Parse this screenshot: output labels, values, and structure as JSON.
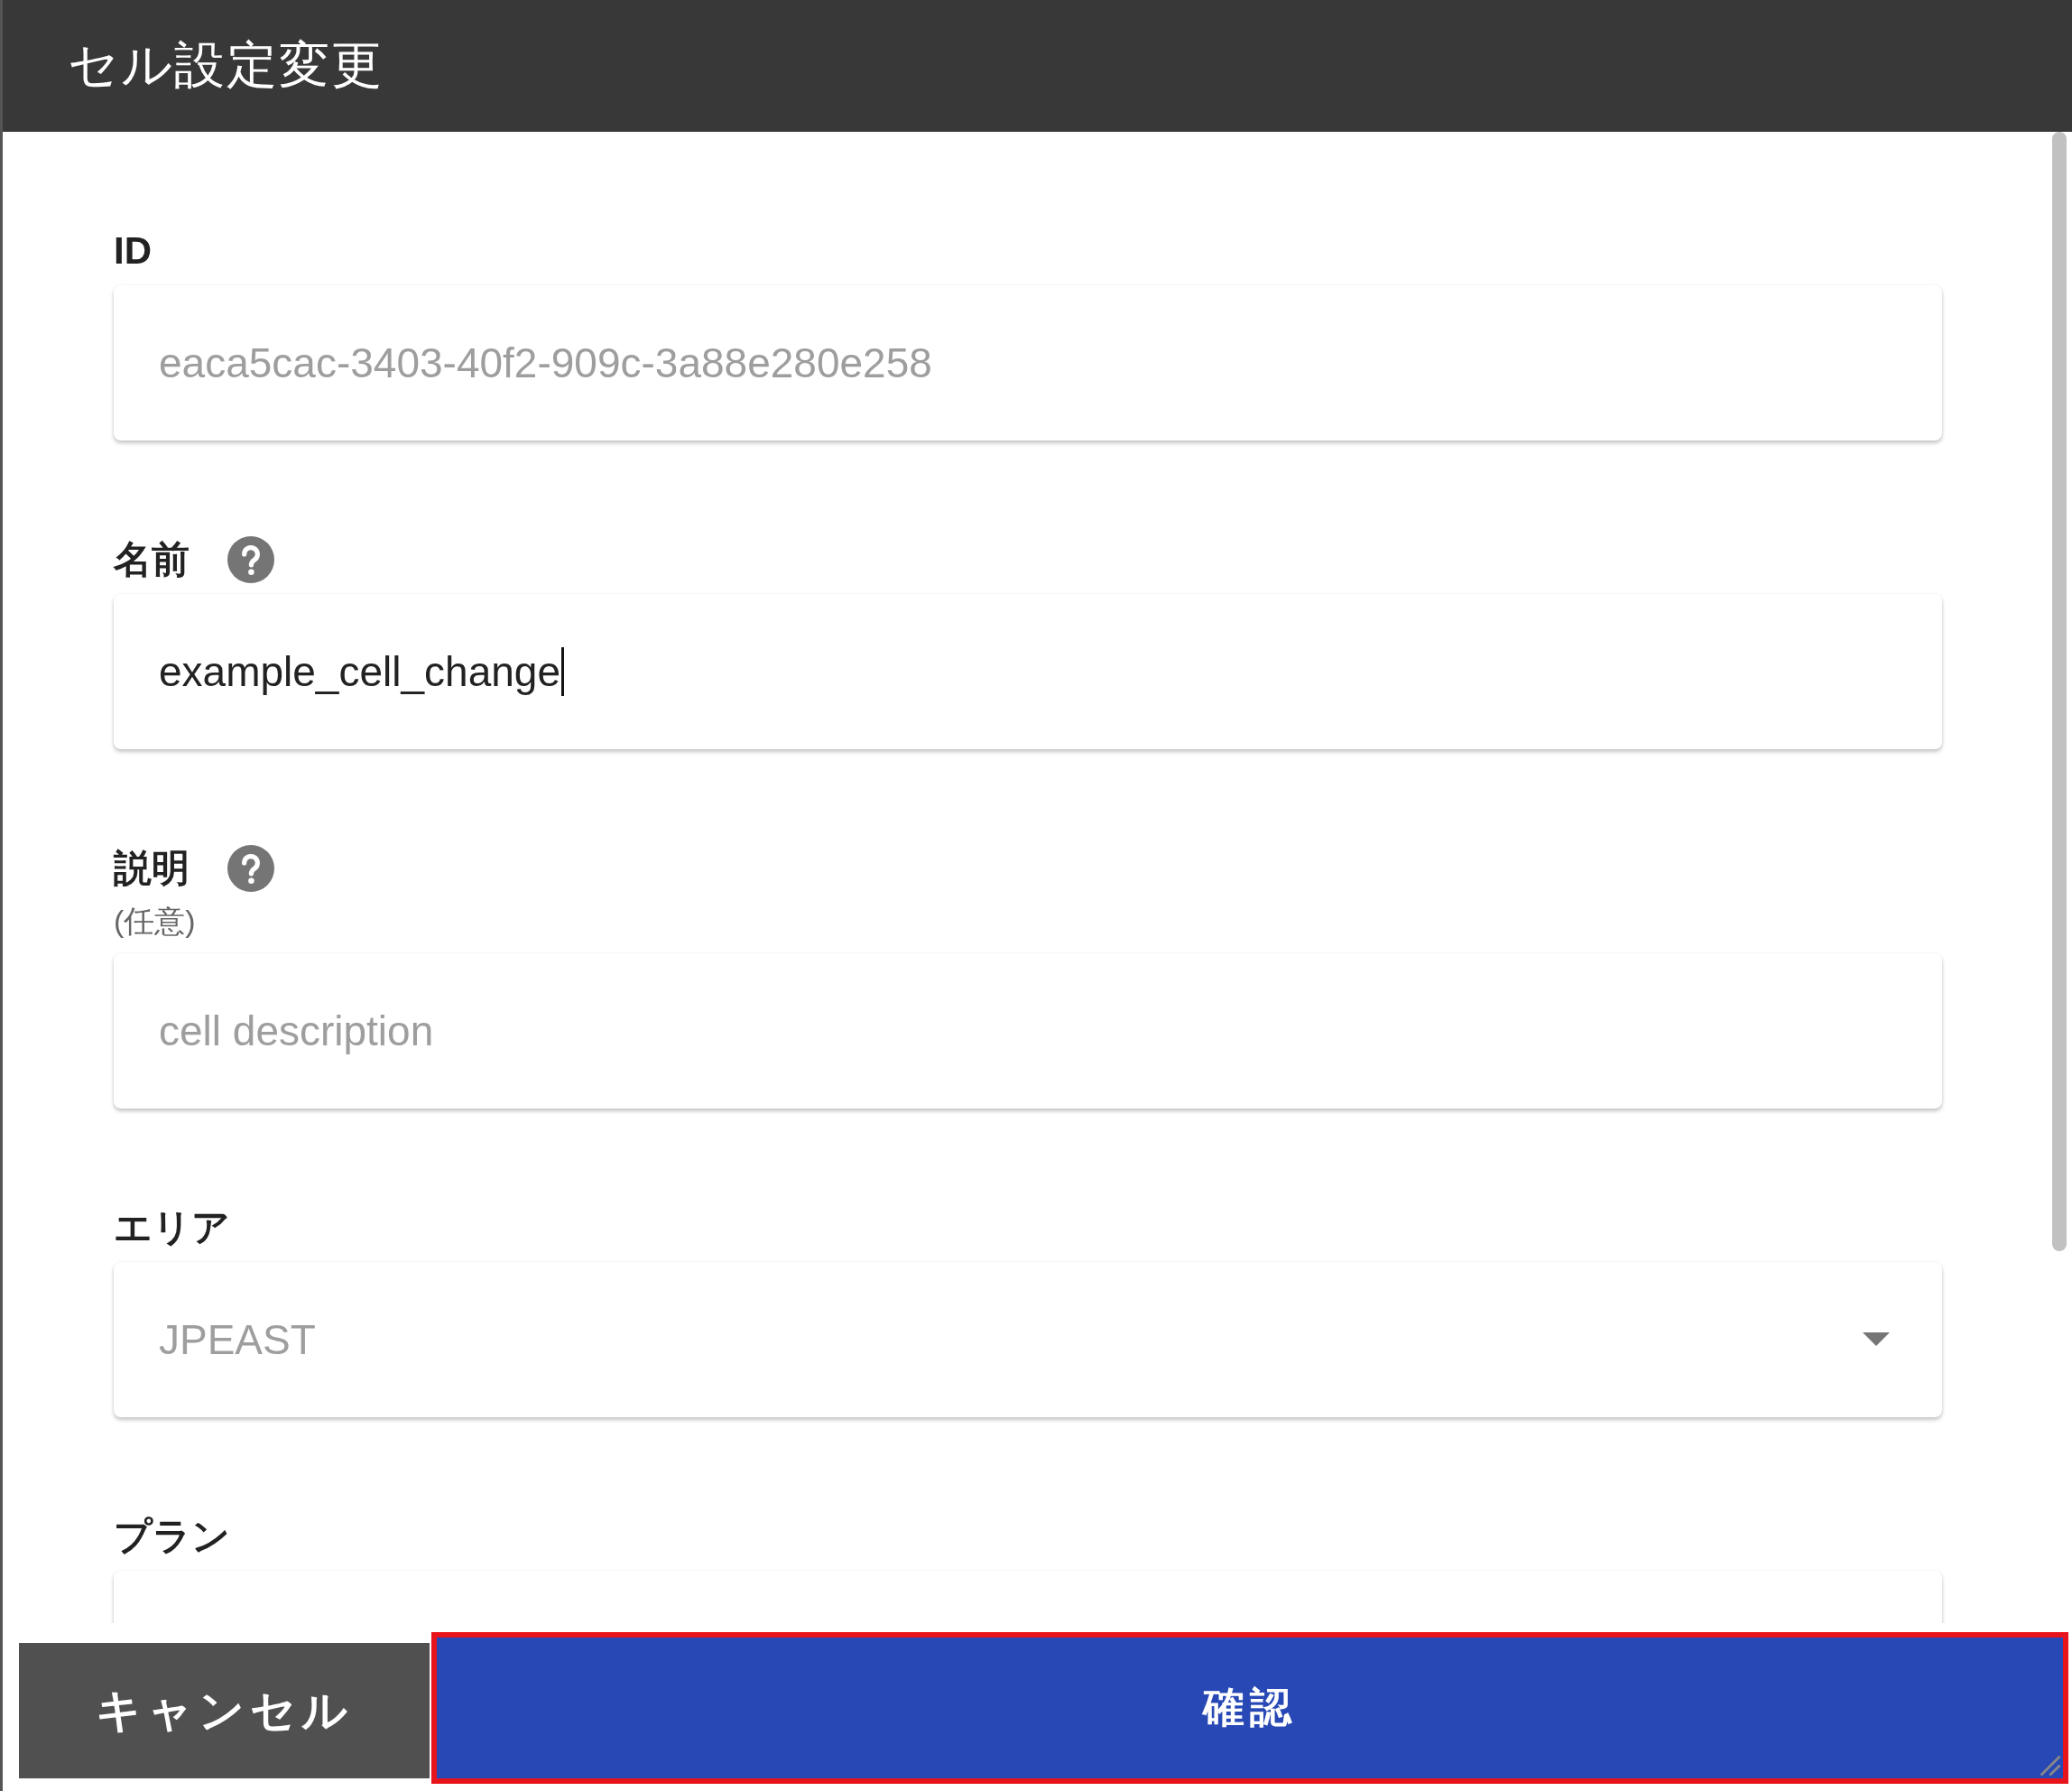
{
  "dialog": {
    "title": "セル設定変更"
  },
  "fields": [
    {
      "label": "ID",
      "kind": "text",
      "value": "eaca5cac-3403-40f2-909c-3a88e280e258",
      "disabled": true,
      "help": false,
      "focused": false
    },
    {
      "label": "名前",
      "kind": "text",
      "value": "example_cell_change",
      "disabled": false,
      "help": true,
      "focused": true
    },
    {
      "label": "説明",
      "note": "(任意)",
      "kind": "text",
      "placeholder": "cell description",
      "disabled": false,
      "help": true,
      "focused": false
    },
    {
      "label": "エリア",
      "kind": "select",
      "value": "JPEAST",
      "disabled": true,
      "help": false,
      "focused": false
    },
    {
      "label": "プラン",
      "kind": "text",
      "help": false
    }
  ],
  "buttons": [
    {
      "label": "キャンセル",
      "kind": "cancel",
      "highlighted": false
    },
    {
      "label": "確認",
      "kind": "confirm",
      "highlighted": true
    }
  ]
}
